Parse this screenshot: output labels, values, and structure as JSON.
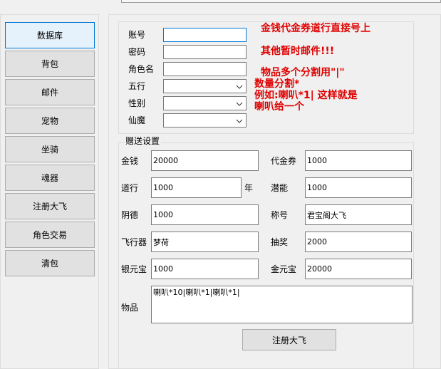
{
  "sidebar": {
    "items": [
      {
        "label": "数据库"
      },
      {
        "label": "背包"
      },
      {
        "label": "邮件"
      },
      {
        "label": "宠物"
      },
      {
        "label": "坐骑"
      },
      {
        "label": "魂器"
      },
      {
        "label": "注册大飞"
      },
      {
        "label": "角色交易"
      },
      {
        "label": "清包"
      }
    ]
  },
  "account": {
    "account_label": "账号",
    "password_label": "密码",
    "role_name_label": "角色名",
    "element_label": "五行",
    "gender_label": "性别",
    "faction_label": "仙魔",
    "account_value": "",
    "password_value": "",
    "role_name_value": ""
  },
  "notes": {
    "line1": "金钱代金券道行直接号上",
    "line2": "其他暂时邮件!!!",
    "line3": "物品多个分割用\"|\"",
    "line4": "数量分割*",
    "line5": "例如:喇叭*1|    这样就是",
    "line6": "喇叭给一个"
  },
  "gift": {
    "title": "赠送设置",
    "money_label": "金钱",
    "money_value": "20000",
    "voucher_label": "代金券",
    "voucher_value": "1000",
    "daoxing_label": "道行",
    "daoxing_value": "1000",
    "daoxing_unit": "年",
    "potential_label": "潜能",
    "potential_value": "1000",
    "yinde_label": "阴德",
    "yinde_value": "1000",
    "title_label": "称号",
    "title_value": "君宝阁大飞",
    "flyer_label": "飞行器",
    "flyer_value": "梦荷",
    "lottery_label": "抽奖",
    "lottery_value": "2000",
    "silver_label": "银元宝",
    "silver_value": "1000",
    "gold_label": "金元宝",
    "gold_value": "20000",
    "items_label": "物品",
    "items_value": "喇叭*10|喇叭*1|喇叭*1|",
    "submit_label": "注册大飞"
  }
}
